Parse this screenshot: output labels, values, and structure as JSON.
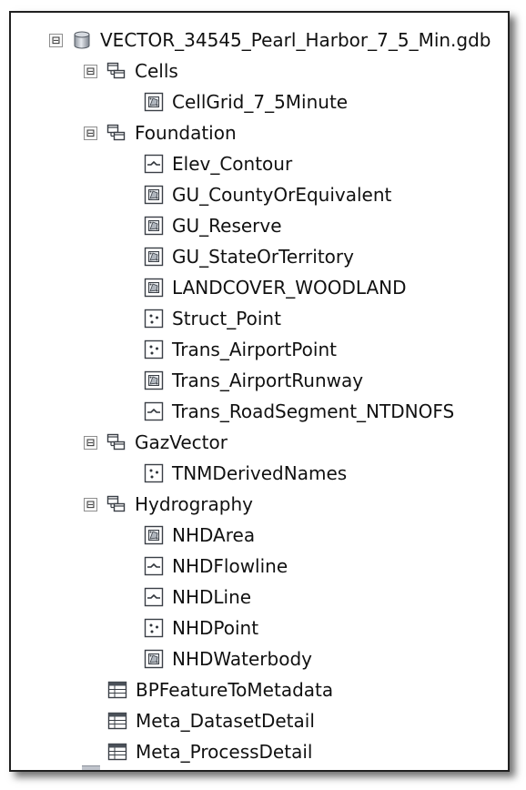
{
  "tree": {
    "root": {
      "label": "VECTOR_34545_Pearl_Harbor_7_5_Min.gdb",
      "icon": "geodatabase-icon",
      "expander": "⊟"
    },
    "groups": [
      {
        "label": "Cells",
        "icon": "feature-dataset-icon",
        "expander": "⊟",
        "items": [
          {
            "label": "CellGrid_7_5Minute",
            "icon": "polygon-feature-class-icon"
          }
        ]
      },
      {
        "label": "Foundation",
        "icon": "feature-dataset-icon",
        "expander": "⊟",
        "items": [
          {
            "label": "Elev_Contour",
            "icon": "line-feature-class-icon"
          },
          {
            "label": "GU_CountyOrEquivalent",
            "icon": "polygon-feature-class-icon"
          },
          {
            "label": "GU_Reserve",
            "icon": "polygon-feature-class-icon"
          },
          {
            "label": "GU_StateOrTerritory",
            "icon": "polygon-feature-class-icon"
          },
          {
            "label": "LANDCOVER_WOODLAND",
            "icon": "polygon-feature-class-icon"
          },
          {
            "label": "Struct_Point",
            "icon": "point-feature-class-icon"
          },
          {
            "label": "Trans_AirportPoint",
            "icon": "point-feature-class-icon"
          },
          {
            "label": "Trans_AirportRunway",
            "icon": "polygon-feature-class-icon"
          },
          {
            "label": "Trans_RoadSegment_NTDNOFS",
            "icon": "line-feature-class-icon"
          }
        ]
      },
      {
        "label": "GazVector",
        "icon": "feature-dataset-icon",
        "expander": "⊟",
        "items": [
          {
            "label": "TNMDerivedNames",
            "icon": "point-feature-class-icon"
          }
        ]
      },
      {
        "label": "Hydrography",
        "icon": "feature-dataset-icon",
        "expander": "⊟",
        "items": [
          {
            "label": "NHDArea",
            "icon": "polygon-feature-class-icon"
          },
          {
            "label": "NHDFlowline",
            "icon": "line-feature-class-icon"
          },
          {
            "label": "NHDLine",
            "icon": "line-feature-class-icon"
          },
          {
            "label": "NHDPoint",
            "icon": "point-feature-class-icon"
          },
          {
            "label": "NHDWaterbody",
            "icon": "polygon-feature-class-icon"
          }
        ]
      }
    ],
    "tables": [
      {
        "label": "BPFeatureToMetadata",
        "icon": "table-icon"
      },
      {
        "label": "Meta_DatasetDetail",
        "icon": "table-icon"
      },
      {
        "label": "Meta_ProcessDetail",
        "icon": "table-icon"
      }
    ]
  }
}
